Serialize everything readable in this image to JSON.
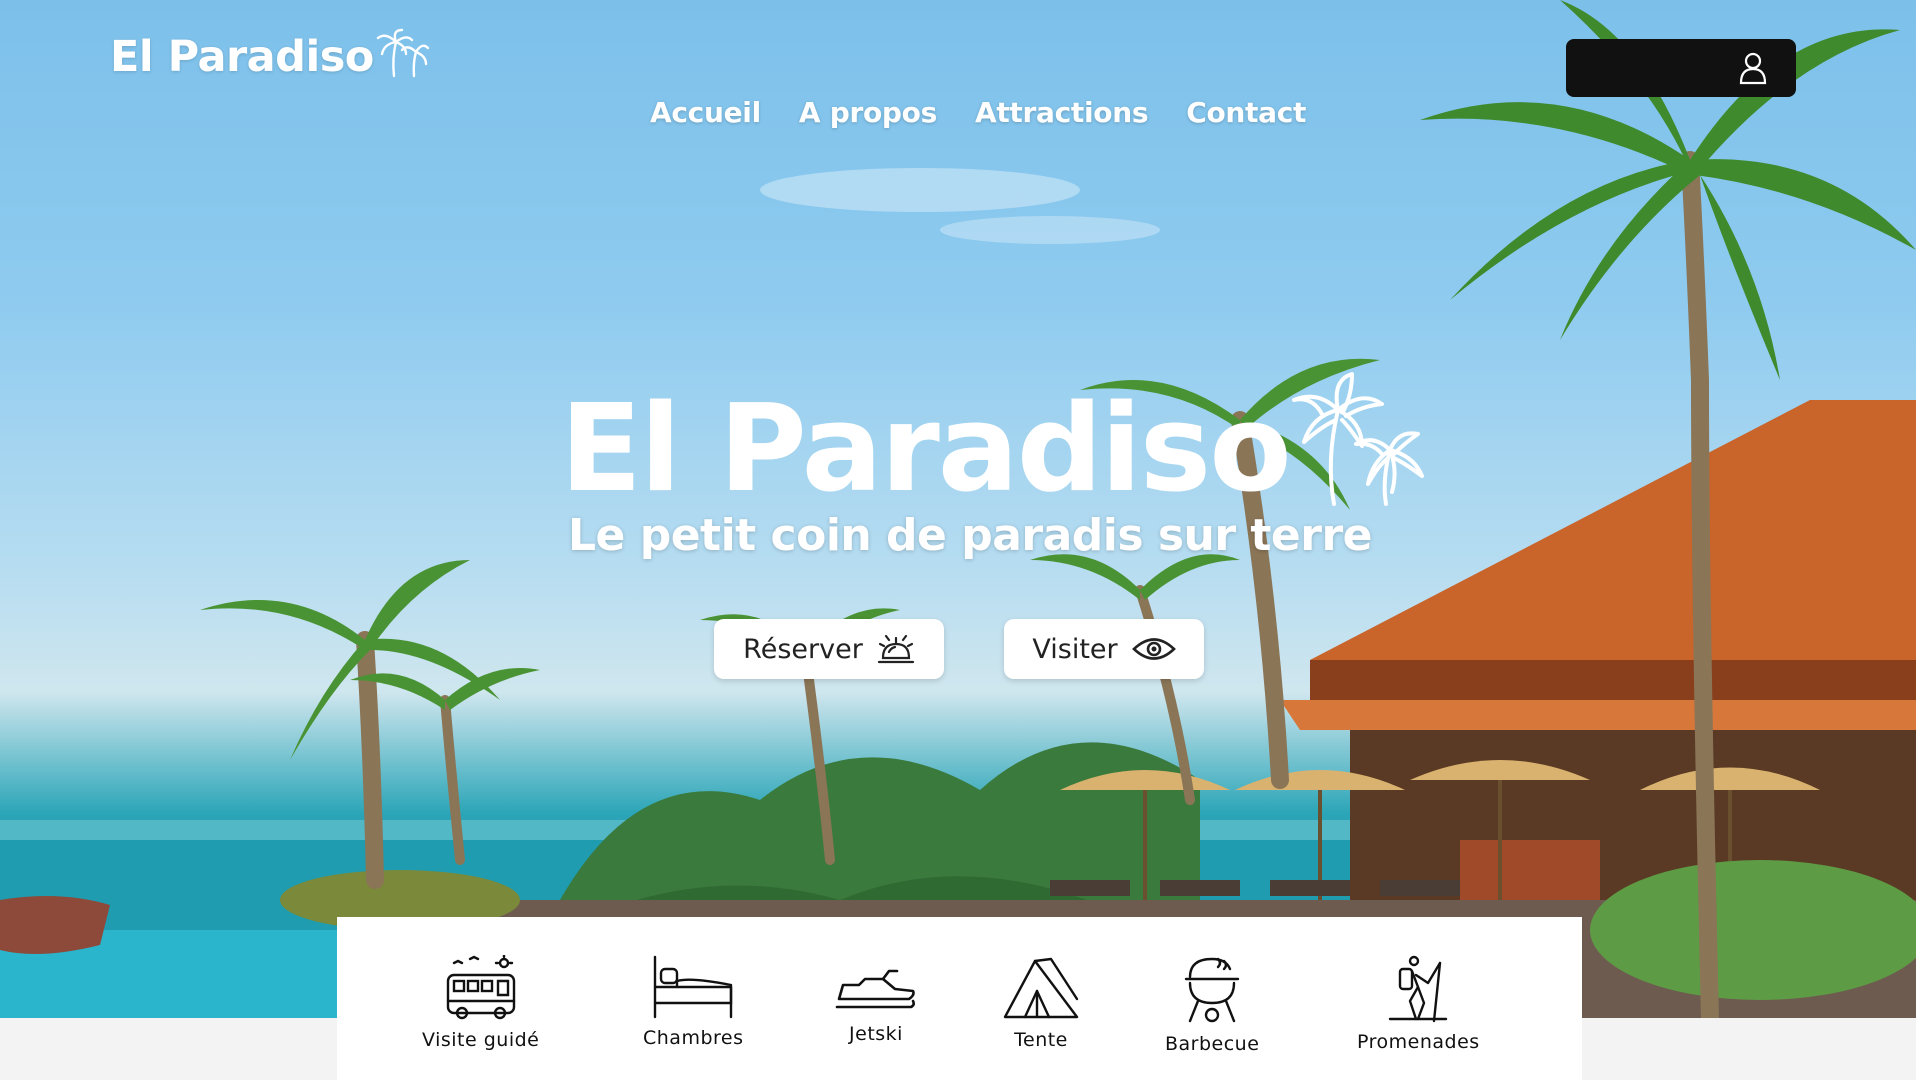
{
  "brand": {
    "name": "El Paradiso"
  },
  "nav": {
    "items": [
      "Accueil",
      "A propos",
      "Attractions",
      "Contact"
    ]
  },
  "hero": {
    "title": "El Paradiso",
    "subtitle": "Le petit coin de paradis sur terre",
    "reserve_label": "Réserver",
    "visit_label": "Visiter"
  },
  "amenities": [
    {
      "label": "Visite guidé",
      "icon": "bus-icon"
    },
    {
      "label": "Chambres",
      "icon": "bed-icon"
    },
    {
      "label": "Jetski",
      "icon": "jetski-icon"
    },
    {
      "label": "Tente",
      "icon": "tent-icon"
    },
    {
      "label": "Barbecue",
      "icon": "barbecue-icon"
    },
    {
      "label": "Promenades",
      "icon": "hiker-icon"
    }
  ],
  "colors": {
    "text_on_hero": "#ffffff",
    "account_bar": "#111111",
    "sky": "#7cc0ea",
    "sea": "#1e8a9a"
  }
}
